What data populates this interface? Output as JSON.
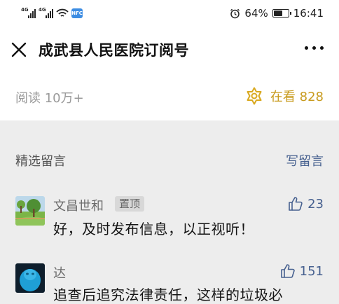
{
  "status_bar": {
    "signal1_label": "4G",
    "signal2_label": "4G",
    "nfc_label": "NFC",
    "battery_percent": "64%",
    "battery_level": 0.64,
    "time": "16:41"
  },
  "header": {
    "title": "成武县人民医院订阅号"
  },
  "stats": {
    "reads": "阅读 10万+",
    "zaikan": "在看 828"
  },
  "comments_section": {
    "title": "精选留言",
    "write_label": "写留言",
    "comments": [
      {
        "name": "文昌世和",
        "badge": "置顶",
        "text": "好，及时发布信息，以正视听！",
        "likes": "23"
      },
      {
        "name": "达",
        "text": "追查后追究法律责任，这样的垃圾必",
        "likes": "151"
      }
    ]
  },
  "colors": {
    "accent_gold": "#c89b1e",
    "link_blue": "#46608f",
    "page_gray": "#ededed"
  },
  "icons": [
    "close-icon",
    "more-icon",
    "zaikan-icon",
    "thumbs-up-icon",
    "wifi-icon",
    "alarm-icon",
    "battery-icon"
  ]
}
